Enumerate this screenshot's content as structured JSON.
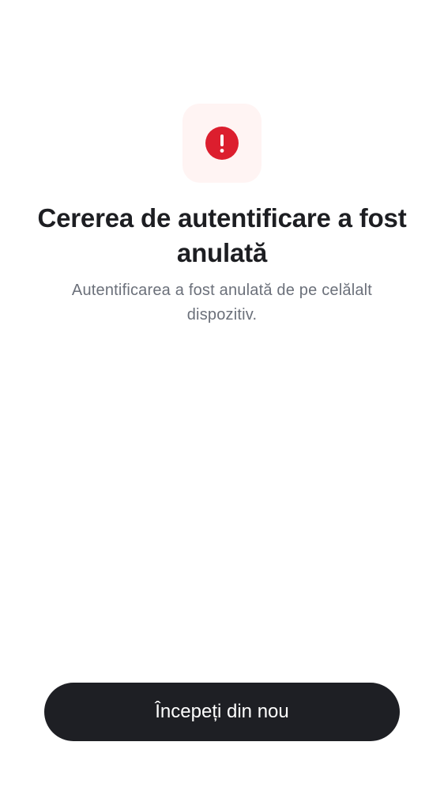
{
  "status": {
    "icon": "error-icon",
    "icon_color": "#dc1e2e",
    "tile_color": "#fff4f3"
  },
  "title": "Cererea de autentificare a fost anulată",
  "subtitle": "Autentificarea a fost anulată de pe celălalt dispozitiv.",
  "actions": {
    "restart_label": "Începeți din nou",
    "button_color": "#1e1f24"
  }
}
